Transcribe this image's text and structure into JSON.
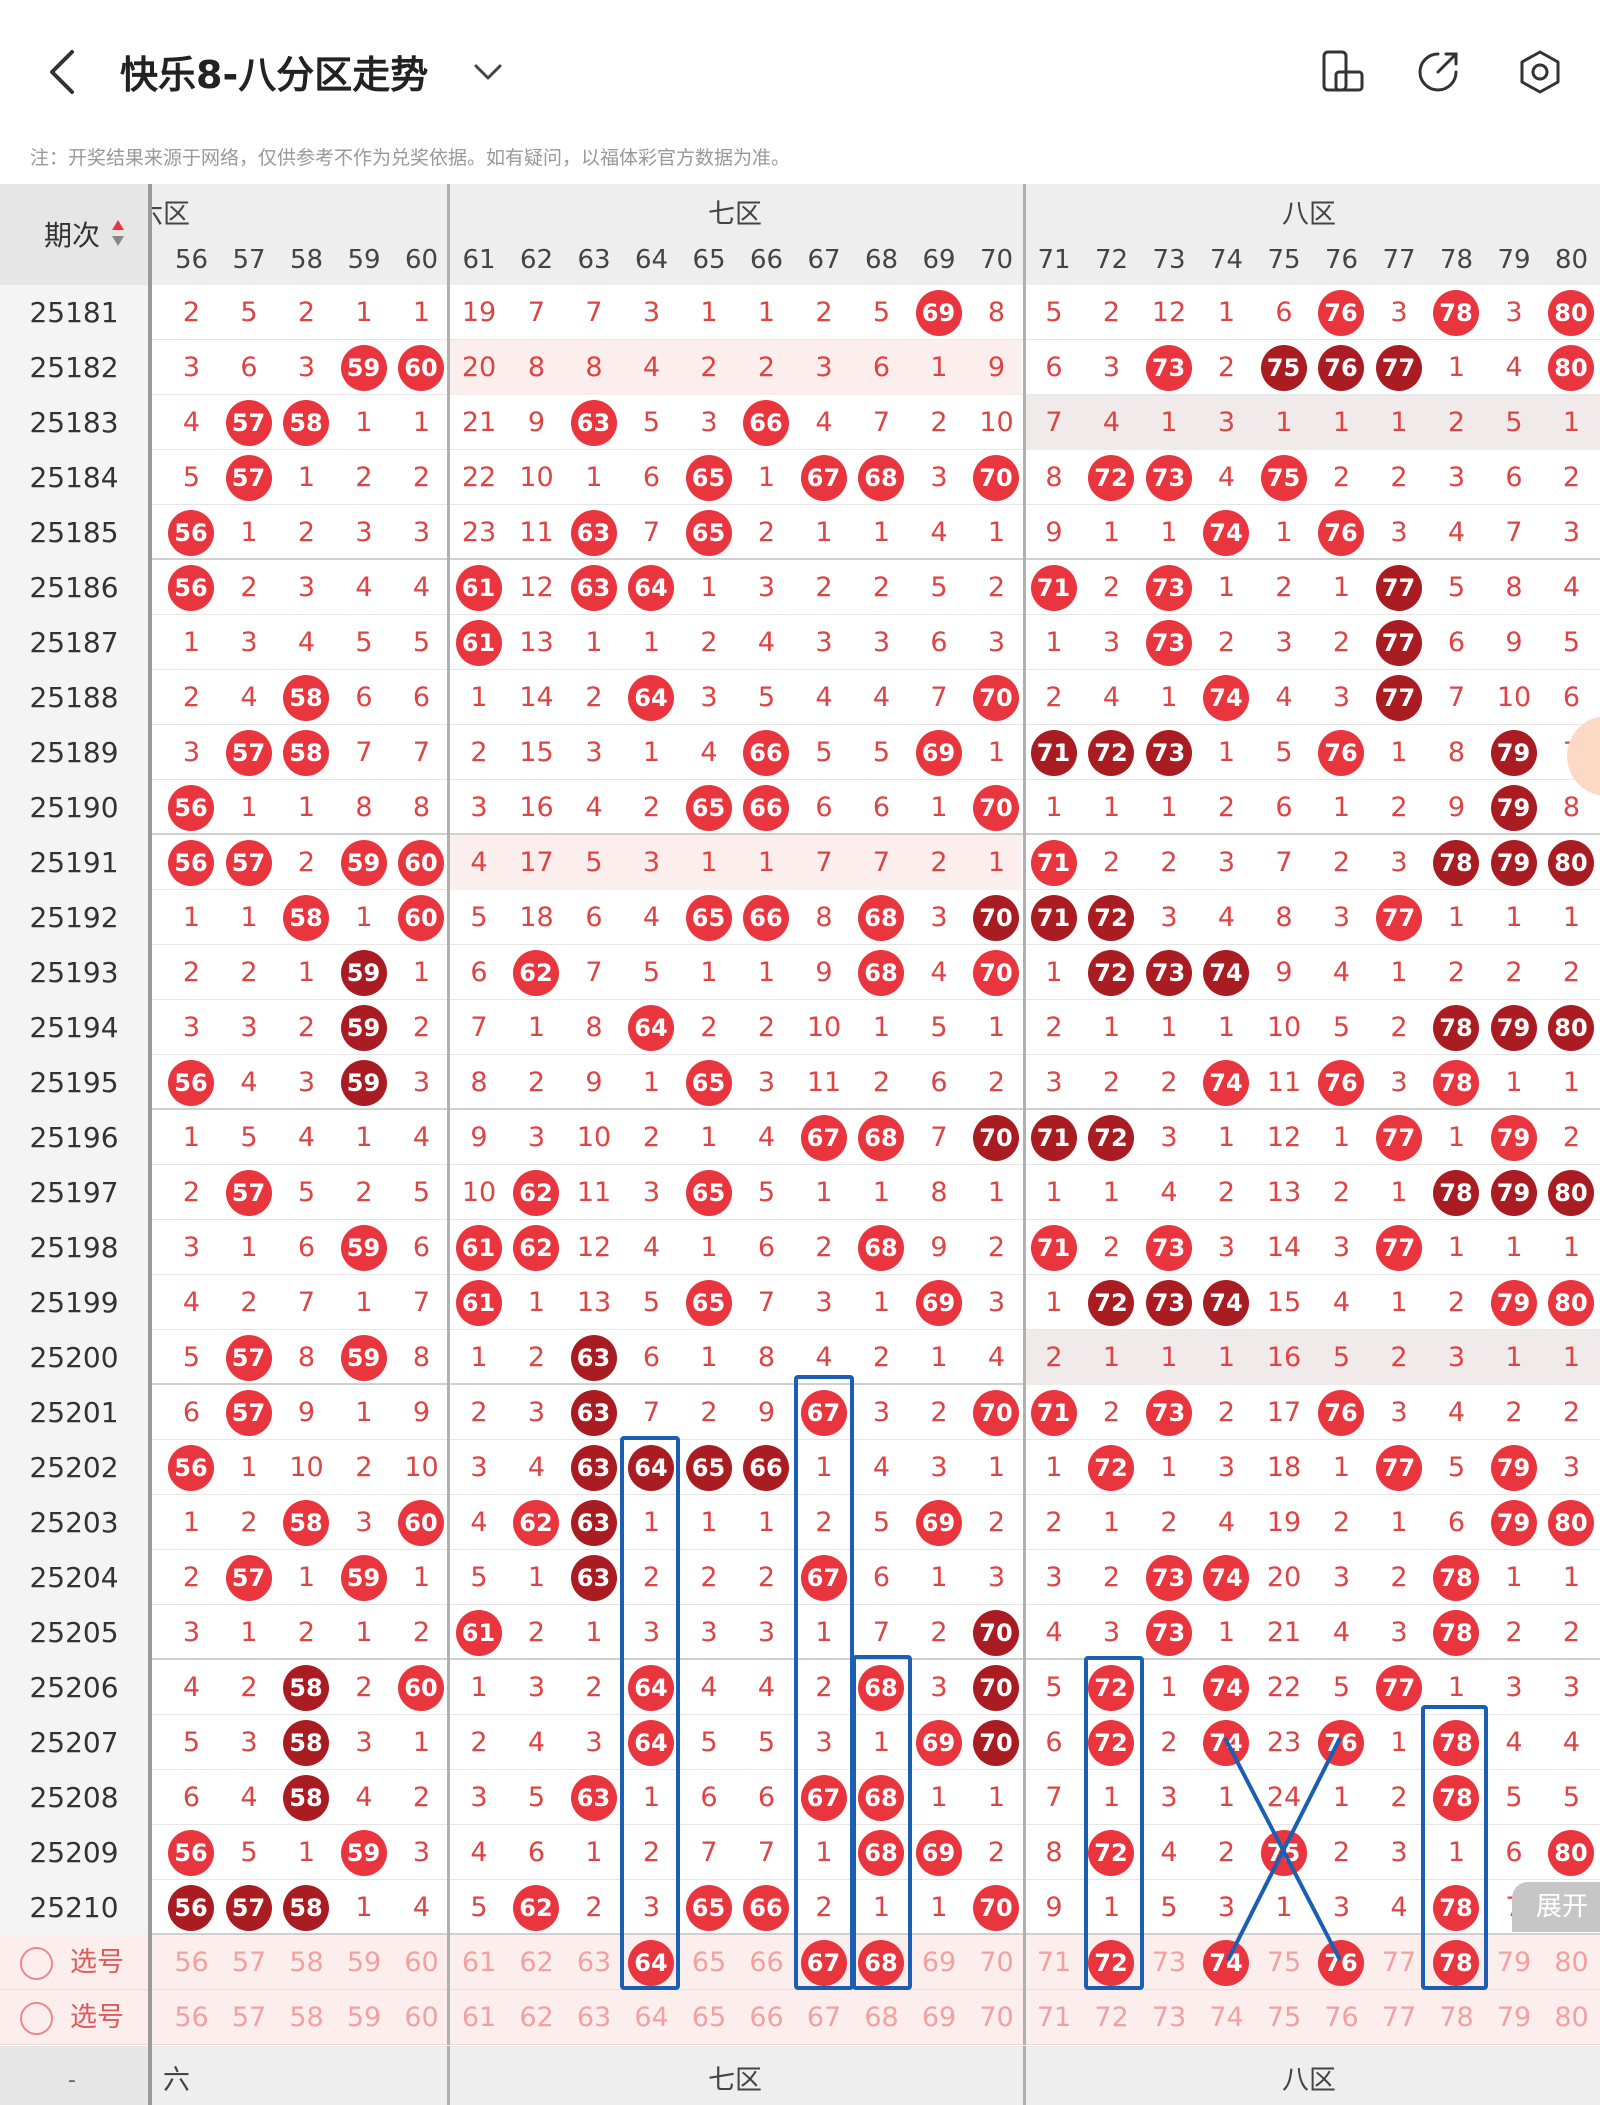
{
  "header": {
    "title": "快乐8-八分区走势"
  },
  "note": "注：开奖结果来源于网络，仅供参考不作为兑奖依据。如有疑问，以福体彩官方数据为准。",
  "zones": {
    "left_partial": "六区",
    "seven": "七区",
    "eight": "八区"
  },
  "issue_header": "期次",
  "columns": [
    "56",
    "57",
    "58",
    "59",
    "60",
    "61",
    "62",
    "63",
    "64",
    "65",
    "66",
    "67",
    "68",
    "69",
    "70",
    "71",
    "72",
    "73",
    "74",
    "75",
    "76",
    "77",
    "78",
    "79",
    "80"
  ],
  "rows": [
    {
      "issue": "25181",
      "cells": [
        "2",
        "5",
        "2",
        "1",
        "1",
        "19",
        "7",
        "7",
        "3",
        "1",
        "1",
        "2",
        "5",
        "69*",
        "8",
        "5",
        "2",
        "12",
        "1",
        "6",
        "76*",
        "3",
        "78*",
        "3",
        "80*"
      ]
    },
    {
      "issue": "25182",
      "cells": [
        "3",
        "6",
        "3",
        "59*",
        "60*",
        "20",
        "8",
        "8",
        "4",
        "2",
        "2",
        "3",
        "6",
        "1",
        "9",
        "6",
        "3",
        "73*",
        "2",
        "75#",
        "76#",
        "77#",
        "1",
        "4",
        "80*"
      ]
    },
    {
      "issue": "25183",
      "cells": [
        "4",
        "57*",
        "58*",
        "1",
        "1",
        "21",
        "9",
        "63*",
        "5",
        "3",
        "66*",
        "4",
        "7",
        "2",
        "10",
        "7",
        "4",
        "1",
        "3",
        "1",
        "1",
        "1",
        "2",
        "5",
        "1"
      ]
    },
    {
      "issue": "25184",
      "cells": [
        "5",
        "57*",
        "1",
        "2",
        "2",
        "22",
        "10",
        "1",
        "6",
        "65*",
        "1",
        "67*",
        "68*",
        "3",
        "70*",
        "8",
        "72*",
        "73*",
        "4",
        "75*",
        "2",
        "2",
        "3",
        "6",
        "2"
      ]
    },
    {
      "issue": "25185",
      "cells": [
        "56*",
        "1",
        "2",
        "3",
        "3",
        "23",
        "11",
        "63*",
        "7",
        "65*",
        "2",
        "1",
        "1",
        "4",
        "1",
        "9",
        "1",
        "1",
        "74*",
        "1",
        "76*",
        "3",
        "4",
        "7",
        "3"
      ]
    },
    {
      "issue": "25186",
      "cells": [
        "56*",
        "2",
        "3",
        "4",
        "4",
        "61*",
        "12",
        "63*",
        "64*",
        "1",
        "3",
        "2",
        "2",
        "5",
        "2",
        "71*",
        "2",
        "73*",
        "1",
        "2",
        "1",
        "77#",
        "5",
        "8",
        "4"
      ]
    },
    {
      "issue": "25187",
      "cells": [
        "1",
        "3",
        "4",
        "5",
        "5",
        "61*",
        "13",
        "1",
        "1",
        "2",
        "4",
        "3",
        "3",
        "6",
        "3",
        "1",
        "3",
        "73*",
        "2",
        "3",
        "2",
        "77#",
        "6",
        "9",
        "5"
      ]
    },
    {
      "issue": "25188",
      "cells": [
        "2",
        "4",
        "58*",
        "6",
        "6",
        "1",
        "14",
        "2",
        "64*",
        "3",
        "5",
        "4",
        "4",
        "7",
        "70*",
        "2",
        "4",
        "1",
        "74*",
        "4",
        "3",
        "77#",
        "7",
        "10",
        "6"
      ]
    },
    {
      "issue": "25189",
      "cells": [
        "3",
        "57*",
        "58*",
        "7",
        "7",
        "2",
        "15",
        "3",
        "1",
        "4",
        "66*",
        "5",
        "5",
        "69*",
        "1",
        "71#",
        "72#",
        "73#",
        "1",
        "5",
        "76*",
        "1",
        "8",
        "79#",
        "7"
      ]
    },
    {
      "issue": "25190",
      "cells": [
        "56*",
        "1",
        "1",
        "8",
        "8",
        "3",
        "16",
        "4",
        "2",
        "65*",
        "66*",
        "6",
        "6",
        "1",
        "70*",
        "1",
        "1",
        "1",
        "2",
        "6",
        "1",
        "2",
        "9",
        "79#",
        "8"
      ]
    },
    {
      "issue": "25191",
      "cells": [
        "56*",
        "57*",
        "2",
        "59*",
        "60*",
        "4",
        "17",
        "5",
        "3",
        "1",
        "1",
        "7",
        "7",
        "2",
        "1",
        "71*",
        "2",
        "2",
        "3",
        "7",
        "2",
        "3",
        "78#",
        "79#",
        "80#"
      ]
    },
    {
      "issue": "25192",
      "cells": [
        "1",
        "1",
        "58*",
        "1",
        "60*",
        "5",
        "18",
        "6",
        "4",
        "65*",
        "66*",
        "8",
        "68*",
        "3",
        "70#",
        "71#",
        "72#",
        "3",
        "4",
        "8",
        "3",
        "77*",
        "1",
        "1",
        "1"
      ]
    },
    {
      "issue": "25193",
      "cells": [
        "2",
        "2",
        "1",
        "59#",
        "1",
        "6",
        "62*",
        "7",
        "5",
        "1",
        "1",
        "9",
        "68*",
        "4",
        "70*",
        "1",
        "72#",
        "73#",
        "74#",
        "9",
        "4",
        "1",
        "2",
        "2",
        "2"
      ]
    },
    {
      "issue": "25194",
      "cells": [
        "3",
        "3",
        "2",
        "59#",
        "2",
        "7",
        "1",
        "8",
        "64*",
        "2",
        "2",
        "10",
        "1",
        "5",
        "1",
        "2",
        "1",
        "1",
        "1",
        "10",
        "5",
        "2",
        "78#",
        "79#",
        "80#"
      ]
    },
    {
      "issue": "25195",
      "cells": [
        "56*",
        "4",
        "3",
        "59#",
        "3",
        "8",
        "2",
        "9",
        "1",
        "65*",
        "3",
        "11",
        "2",
        "6",
        "2",
        "3",
        "2",
        "2",
        "74*",
        "11",
        "76*",
        "3",
        "78*",
        "1",
        "1"
      ]
    },
    {
      "issue": "25196",
      "cells": [
        "1",
        "5",
        "4",
        "1",
        "4",
        "9",
        "3",
        "10",
        "2",
        "1",
        "4",
        "67*",
        "68*",
        "7",
        "70#",
        "71#",
        "72#",
        "3",
        "1",
        "12",
        "1",
        "77*",
        "1",
        "79*",
        "2"
      ]
    },
    {
      "issue": "25197",
      "cells": [
        "2",
        "57*",
        "5",
        "2",
        "5",
        "10",
        "62*",
        "11",
        "3",
        "65*",
        "5",
        "1",
        "1",
        "8",
        "1",
        "1",
        "1",
        "4",
        "2",
        "13",
        "2",
        "1",
        "78#",
        "79#",
        "80#"
      ]
    },
    {
      "issue": "25198",
      "cells": [
        "3",
        "1",
        "6",
        "59*",
        "6",
        "61*",
        "62*",
        "12",
        "4",
        "1",
        "6",
        "2",
        "68*",
        "9",
        "2",
        "71*",
        "2",
        "73*",
        "3",
        "14",
        "3",
        "77*",
        "1",
        "1",
        "1"
      ]
    },
    {
      "issue": "25199",
      "cells": [
        "4",
        "2",
        "7",
        "1",
        "7",
        "61*",
        "1",
        "13",
        "5",
        "65*",
        "7",
        "3",
        "1",
        "69*",
        "3",
        "1",
        "72#",
        "73#",
        "74#",
        "15",
        "4",
        "1",
        "2",
        "79*",
        "80*"
      ]
    },
    {
      "issue": "25200",
      "cells": [
        "5",
        "57*",
        "8",
        "59*",
        "8",
        "1",
        "2",
        "63#",
        "6",
        "1",
        "8",
        "4",
        "2",
        "1",
        "4",
        "2",
        "1",
        "1",
        "1",
        "16",
        "5",
        "2",
        "3",
        "1",
        "1"
      ]
    },
    {
      "issue": "25201",
      "cells": [
        "6",
        "57*",
        "9",
        "1",
        "9",
        "2",
        "3",
        "63#",
        "7",
        "2",
        "9",
        "67*",
        "3",
        "2",
        "70*",
        "71*",
        "2",
        "73*",
        "2",
        "17",
        "76*",
        "3",
        "4",
        "2",
        "2"
      ]
    },
    {
      "issue": "25202",
      "cells": [
        "56*",
        "1",
        "10",
        "2",
        "10",
        "3",
        "4",
        "63#",
        "64#",
        "65#",
        "66#",
        "1",
        "4",
        "3",
        "1",
        "1",
        "72*",
        "1",
        "3",
        "18",
        "1",
        "77*",
        "5",
        "79*",
        "3"
      ]
    },
    {
      "issue": "25203",
      "cells": [
        "1",
        "2",
        "58*",
        "3",
        "60*",
        "4",
        "62*",
        "63#",
        "1",
        "1",
        "1",
        "2",
        "5",
        "69*",
        "2",
        "2",
        "1",
        "2",
        "4",
        "19",
        "2",
        "1",
        "6",
        "79*",
        "80*"
      ]
    },
    {
      "issue": "25204",
      "cells": [
        "2",
        "57*",
        "1",
        "59*",
        "1",
        "5",
        "1",
        "63#",
        "2",
        "2",
        "2",
        "67*",
        "6",
        "1",
        "3",
        "3",
        "2",
        "73*",
        "74*",
        "20",
        "3",
        "2",
        "78*",
        "1",
        "1"
      ]
    },
    {
      "issue": "25205",
      "cells": [
        "3",
        "1",
        "2",
        "1",
        "2",
        "61*",
        "2",
        "1",
        "3",
        "3",
        "3",
        "1",
        "7",
        "2",
        "70#",
        "4",
        "3",
        "73*",
        "1",
        "21",
        "4",
        "3",
        "78*",
        "2",
        "2"
      ]
    },
    {
      "issue": "25206",
      "cells": [
        "4",
        "2",
        "58#",
        "2",
        "60*",
        "1",
        "3",
        "2",
        "64*",
        "4",
        "4",
        "2",
        "68*",
        "3",
        "70#",
        "5",
        "72*",
        "1",
        "74*",
        "22",
        "5",
        "77*",
        "1",
        "3",
        "3"
      ]
    },
    {
      "issue": "25207",
      "cells": [
        "5",
        "3",
        "58#",
        "3",
        "1",
        "2",
        "4",
        "3",
        "64*",
        "5",
        "5",
        "3",
        "1",
        "69*",
        "70#",
        "6",
        "72*",
        "2",
        "74*",
        "23",
        "76*",
        "1",
        "78*",
        "4",
        "4"
      ]
    },
    {
      "issue": "25208",
      "cells": [
        "6",
        "4",
        "58#",
        "4",
        "2",
        "3",
        "5",
        "63*",
        "1",
        "6",
        "6",
        "67*",
        "68*",
        "1",
        "1",
        "7",
        "1",
        "3",
        "1",
        "24",
        "1",
        "2",
        "78*",
        "5",
        "5"
      ]
    },
    {
      "issue": "25209",
      "cells": [
        "56*",
        "5",
        "1",
        "59*",
        "3",
        "4",
        "6",
        "1",
        "2",
        "7",
        "7",
        "1",
        "68*",
        "69*",
        "2",
        "8",
        "72*",
        "4",
        "2",
        "75*",
        "2",
        "3",
        "1",
        "6",
        "80*"
      ]
    },
    {
      "issue": "25210",
      "cells": [
        "56#",
        "57#",
        "58#",
        "1",
        "4",
        "5",
        "62*",
        "2",
        "3",
        "65*",
        "66*",
        "2",
        "1",
        "1",
        "70*",
        "9",
        "1",
        "5",
        "3",
        "1",
        "3",
        "4",
        "78*",
        "7",
        "1"
      ]
    }
  ],
  "select_rows": [
    {
      "label": "选号",
      "picked": [
        "64",
        "67",
        "68",
        "72",
        "74",
        "76",
        "78"
      ]
    },
    {
      "label": "选号",
      "picked": []
    }
  ],
  "footer_zones": {
    "left_partial": "六区",
    "seven": "七区",
    "eight": "八区",
    "dash": "-"
  },
  "expand_label": "展开",
  "colors": {
    "ball_red": "#e8353e",
    "ball_dark": "#a81c22",
    "omission_text": "#d44",
    "annotation_blue": "#1a5fb4"
  }
}
